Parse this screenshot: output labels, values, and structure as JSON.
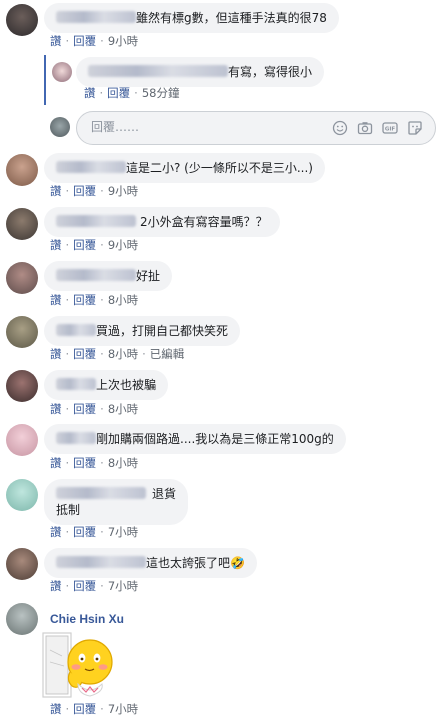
{
  "reply_box": {
    "placeholder": "回覆……"
  },
  "actions": {
    "like": "讚",
    "reply": "回覆"
  },
  "comments": [
    {
      "text": "雖然有標g數，但這種手法真的很78",
      "like": "讚",
      "reply": "回覆",
      "time": "9小時"
    },
    {
      "text": "有寫，寫得很小",
      "like": "讚",
      "reply": "回覆",
      "time": "58分鐘"
    },
    {
      "text": "這是二小? (少一條所以不是三小...)",
      "like": "讚",
      "reply": "回覆",
      "time": "9小時"
    },
    {
      "text": "2小外盒有寫容量嗎？？",
      "like": "讚",
      "reply": "回覆",
      "time": "9小時"
    },
    {
      "text": "好扯",
      "like": "讚",
      "reply": "回覆",
      "time": "8小時"
    },
    {
      "text": "買過，打開自己都快笑死",
      "like": "讚",
      "reply": "回覆",
      "time": "8小時",
      "edited": "已編輯"
    },
    {
      "text": "上次也被騙",
      "like": "讚",
      "reply": "回覆",
      "time": "8小時"
    },
    {
      "text": "剛加購兩個路過....我以為是三條正常100g的",
      "like": "讚",
      "reply": "回覆",
      "time": "8小時"
    },
    {
      "text": "退貨",
      "text2": "抵制",
      "like": "讚",
      "reply": "回覆",
      "time": "7小時"
    },
    {
      "text": "這也太誇張了吧🤣",
      "like": "讚",
      "reply": "回覆",
      "time": "7小時"
    },
    {
      "name": "Chie Hsin Xu",
      "like": "讚",
      "reply": "回覆",
      "time": "7小時"
    }
  ]
}
